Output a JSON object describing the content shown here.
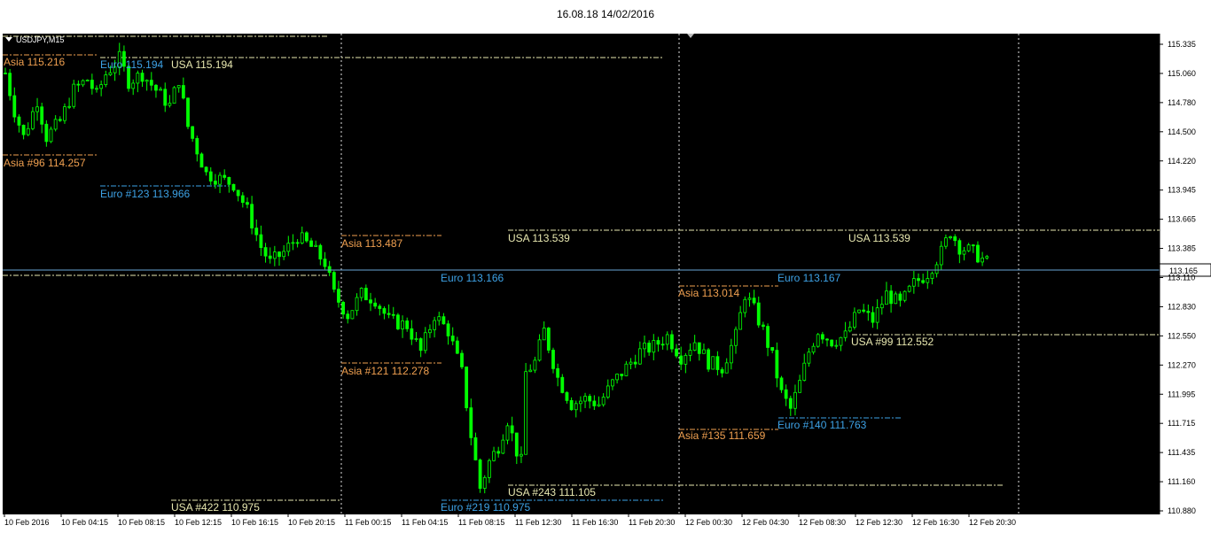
{
  "window_title": "16.08.18 14/02/2016",
  "symbol_label": "USDJPY,M15",
  "current_price": "113.165",
  "colors": {
    "background": "#000000",
    "candle": "#00ff00",
    "asia": "#f0a050",
    "euro": "#3da2e6",
    "usa": "#e8e8b0",
    "current_line": "#6aa6d6",
    "grid_separator": "#e0e0e0"
  },
  "price_axis": [
    "115.335",
    "115.060",
    "114.780",
    "114.500",
    "114.220",
    "113.945",
    "113.665",
    "113.385",
    "113.110",
    "112.830",
    "112.550",
    "112.270",
    "111.995",
    "111.715",
    "111.435",
    "111.160",
    "110.880"
  ],
  "time_axis": [
    "10 Feb 2016",
    "10 Feb 04:15",
    "10 Feb 08:15",
    "10 Feb 12:15",
    "10 Feb 16:15",
    "10 Feb 20:15",
    "11 Feb 00:15",
    "11 Feb 04:15",
    "11 Feb 08:15",
    "11 Feb 12:30",
    "11 Feb 16:30",
    "11 Feb 20:30",
    "12 Feb 00:30",
    "12 Feb 04:30",
    "12 Feb 08:30",
    "12 Feb 12:30",
    "12 Feb 16:30",
    "12 Feb 20:30"
  ],
  "session_labels": {
    "asia_115216": "Asia 115.216",
    "euro_115194": "Euro 115.194",
    "usa_115194": "USA 115.194",
    "asia96": "Asia #96 114.257",
    "euro123": "Euro #123 113.966",
    "asia_113487": "Asia 113.487",
    "euro_113166": "Euro 113.166",
    "usa_113539_a": "USA 113.539",
    "usa_113539_b": "USA 113.539",
    "euro_113167": "Euro 113.167",
    "asia_113014": "Asia 113.014",
    "asia121": "Asia #121 112.278",
    "usa99": "USA #99 112.552",
    "euro140": "Euro #140 111.763",
    "asia135": "Asia #135 111.659",
    "usa243": "USA #243 111.105",
    "usa422": "USA #422 110.975",
    "euro219": "Euro #219 110.975"
  },
  "chart_data": {
    "type": "candlestick",
    "symbol": "USDJPY",
    "timeframe": "M15",
    "ylim": [
      110.88,
      115.335
    ],
    "x_start": "10 Feb 2016",
    "x_end": "12 Feb 20:30",
    "current": 113.165,
    "path": [
      [
        0,
        115.06
      ],
      [
        2,
        114.7
      ],
      [
        4,
        114.45
      ],
      [
        7,
        114.8
      ],
      [
        9,
        114.45
      ],
      [
        12,
        114.6
      ],
      [
        15,
        114.9
      ],
      [
        18,
        115.0
      ],
      [
        20,
        114.85
      ],
      [
        22,
        115.05
      ],
      [
        25,
        115.2
      ],
      [
        27,
        114.98
      ],
      [
        30,
        115.05
      ],
      [
        33,
        114.9
      ],
      [
        36,
        114.75
      ],
      [
        38,
        115.0
      ],
      [
        40,
        114.55
      ],
      [
        44,
        114.1
      ],
      [
        47,
        114.05
      ],
      [
        50,
        114.0
      ],
      [
        53,
        113.75
      ],
      [
        56,
        113.4
      ],
      [
        58,
        113.25
      ],
      [
        61,
        113.35
      ],
      [
        64,
        113.5
      ],
      [
        67,
        113.4
      ],
      [
        70,
        113.25
      ],
      [
        72,
        112.95
      ],
      [
        75,
        112.75
      ],
      [
        78,
        112.95
      ],
      [
        81,
        112.9
      ],
      [
        84,
        112.7
      ],
      [
        88,
        112.65
      ],
      [
        91,
        112.4
      ],
      [
        94,
        112.75
      ],
      [
        97,
        112.6
      ],
      [
        100,
        112.2
      ],
      [
        102,
        111.6
      ],
      [
        104,
        111.1
      ],
      [
        106,
        111.35
      ],
      [
        108,
        111.5
      ],
      [
        110,
        111.75
      ],
      [
        112,
        111.45
      ],
      [
        113,
        111.35
      ],
      [
        114,
        112.2
      ],
      [
        116,
        112.3
      ],
      [
        118,
        112.6
      ],
      [
        121,
        112.15
      ],
      [
        124,
        111.9
      ],
      [
        127,
        111.95
      ],
      [
        130,
        111.9
      ],
      [
        133,
        112.1
      ],
      [
        136,
        112.25
      ],
      [
        139,
        112.4
      ],
      [
        142,
        112.45
      ],
      [
        145,
        112.55
      ],
      [
        148,
        112.35
      ],
      [
        151,
        112.5
      ],
      [
        154,
        112.3
      ],
      [
        157,
        112.25
      ],
      [
        160,
        112.55
      ],
      [
        162,
        112.95
      ],
      [
        164,
        112.8
      ],
      [
        166,
        112.6
      ],
      [
        168,
        112.35
      ],
      [
        170,
        112.0
      ],
      [
        172,
        111.85
      ],
      [
        174,
        112.1
      ],
      [
        176,
        112.4
      ],
      [
        178,
        112.6
      ],
      [
        181,
        112.5
      ],
      [
        184,
        112.55
      ],
      [
        187,
        112.8
      ],
      [
        190,
        112.7
      ],
      [
        193,
        112.95
      ],
      [
        196,
        112.85
      ],
      [
        199,
        113.05
      ],
      [
        202,
        113.15
      ],
      [
        205,
        113.35
      ],
      [
        207,
        113.55
      ],
      [
        209,
        113.4
      ],
      [
        212,
        113.35
      ],
      [
        215,
        113.25
      ]
    ],
    "series": [
      {
        "name": "Asia",
        "levels": [
          115.216,
          114.257,
          113.487,
          113.014,
          112.278,
          111.659
        ]
      },
      {
        "name": "Euro",
        "levels": [
          115.194,
          113.966,
          113.166,
          113.167,
          111.763,
          110.975
        ]
      },
      {
        "name": "USA",
        "levels": [
          115.194,
          113.539,
          113.539,
          112.552,
          111.105,
          110.975
        ]
      }
    ]
  }
}
